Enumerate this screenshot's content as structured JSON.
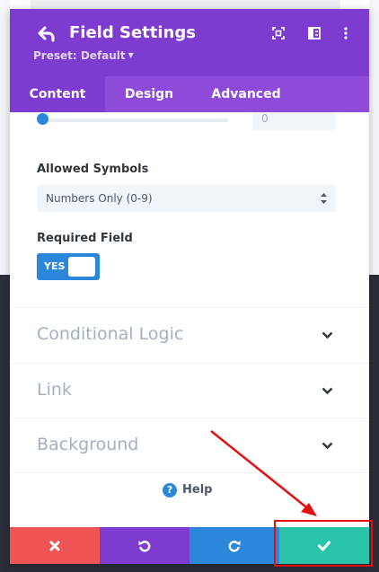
{
  "header": {
    "title": "Field Settings",
    "preset_label": "Preset: Default",
    "icons": [
      "back-arrow-icon",
      "expand-icon",
      "split-view-icon",
      "more-vertical-icon"
    ]
  },
  "tabs": [
    {
      "label": "Content",
      "active": true
    },
    {
      "label": "Design",
      "active": false
    },
    {
      "label": "Advanced",
      "active": false
    }
  ],
  "slider": {
    "value": "0",
    "level": 0
  },
  "allowed_symbols": {
    "label": "Allowed Symbols",
    "selected": "Numbers Only (0-9)"
  },
  "required_field": {
    "label": "Required Field",
    "toggle_text": "YES",
    "on": true
  },
  "sections": [
    {
      "title": "Conditional Logic"
    },
    {
      "title": "Link"
    },
    {
      "title": "Background"
    }
  ],
  "help": {
    "label": "Help",
    "icon": "?"
  },
  "footer": {
    "buttons": [
      "cancel-icon",
      "undo-icon",
      "redo-icon",
      "save-check-icon"
    ]
  },
  "colors": {
    "header_purple": "#7e3bd0",
    "tab_bar_purple": "#8e4ad9",
    "accent_blue": "#2b87da",
    "cancel_red": "#ef5555",
    "save_green": "#29c4a9",
    "annotation_red": "#e31010"
  }
}
